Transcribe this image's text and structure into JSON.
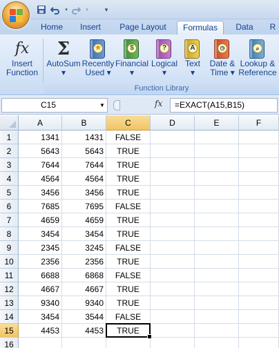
{
  "tabs": [
    "Home",
    "Insert",
    "Page Layout",
    "Formulas",
    "Data",
    "R"
  ],
  "active_tab": "Formulas",
  "ribbon": {
    "buttons": [
      {
        "line1": "Insert",
        "line2": "Function"
      },
      {
        "line1": "AutoSum",
        "line2": "▾"
      },
      {
        "line1": "Recently",
        "line2": "Used ▾"
      },
      {
        "line1": "Financial",
        "line2": "▾"
      },
      {
        "line1": "Logical",
        "line2": "▾"
      },
      {
        "line1": "Text",
        "line2": "▾"
      },
      {
        "line1": "Date &",
        "line2": "Time ▾"
      },
      {
        "line1": "Lookup &",
        "line2": "Reference"
      }
    ],
    "group_label": "Function Library",
    "icons": {
      "insert_function": "fx",
      "autosum": "Σ",
      "logical": "?",
      "text": "A"
    }
  },
  "formula_bar": {
    "name_box": "C15",
    "fx_label": "fx",
    "formula": "=EXACT(A15,B15)"
  },
  "grid": {
    "columns": [
      "A",
      "B",
      "C",
      "D",
      "E",
      "F"
    ],
    "selected_column": "C",
    "selected_row": "15",
    "rows": [
      {
        "n": "1",
        "a": "1341",
        "b": "1431",
        "c": "FALSE"
      },
      {
        "n": "2",
        "a": "5643",
        "b": "5643",
        "c": "TRUE"
      },
      {
        "n": "3",
        "a": "7644",
        "b": "7644",
        "c": "TRUE"
      },
      {
        "n": "4",
        "a": "4564",
        "b": "4564",
        "c": "TRUE"
      },
      {
        "n": "5",
        "a": "3456",
        "b": "3456",
        "c": "TRUE"
      },
      {
        "n": "6",
        "a": "7685",
        "b": "7695",
        "c": "FALSE"
      },
      {
        "n": "7",
        "a": "4659",
        "b": "4659",
        "c": "TRUE"
      },
      {
        "n": "8",
        "a": "3454",
        "b": "3454",
        "c": "TRUE"
      },
      {
        "n": "9",
        "a": "2345",
        "b": "3245",
        "c": "FALSE"
      },
      {
        "n": "10",
        "a": "2356",
        "b": "2356",
        "c": "TRUE"
      },
      {
        "n": "11",
        "a": "6688",
        "b": "6868",
        "c": "FALSE"
      },
      {
        "n": "12",
        "a": "4667",
        "b": "4667",
        "c": "TRUE"
      },
      {
        "n": "13",
        "a": "9340",
        "b": "9340",
        "c": "TRUE"
      },
      {
        "n": "14",
        "a": "3454",
        "b": "3544",
        "c": "FALSE"
      },
      {
        "n": "15",
        "a": "4453",
        "b": "4453",
        "c": "TRUE"
      },
      {
        "n": "16",
        "a": "",
        "b": "",
        "c": ""
      }
    ]
  },
  "colors": {
    "selection_header": "#f2c464",
    "ribbon_text": "#15428b"
  }
}
